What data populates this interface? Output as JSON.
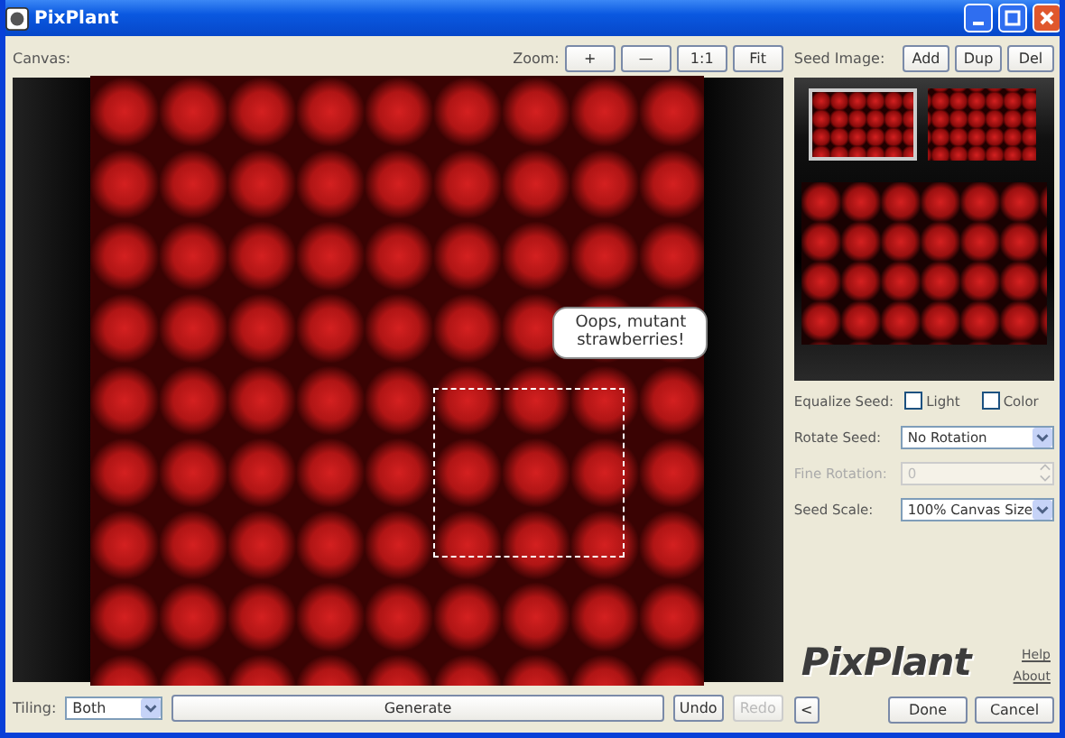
{
  "window": {
    "title": "PixPlant"
  },
  "canvas": {
    "label": "Canvas:",
    "zoom_label": "Zoom:",
    "zoom_buttons": [
      "+",
      "—",
      "1:1",
      "Fit"
    ],
    "callout": "Oops, mutant strawberries!"
  },
  "seed": {
    "label": "Seed Image:",
    "buttons": [
      "Add",
      "Dup",
      "Del"
    ],
    "thumbnails": [
      {
        "selected": true
      },
      {
        "selected": false
      }
    ]
  },
  "settings": {
    "equalize_label": "Equalize Seed:",
    "checkboxes": [
      {
        "label": "Light",
        "checked": false
      },
      {
        "label": "Color",
        "checked": false
      }
    ],
    "fields": [
      {
        "label": "Rotate Seed:",
        "value": "No Rotation",
        "kind": "dropdown",
        "disabled": false
      },
      {
        "label": "Fine Rotation:",
        "value": "0",
        "kind": "spinner",
        "disabled": true
      },
      {
        "label": "Seed Scale:",
        "value": "100% Canvas Size",
        "kind": "dropdown",
        "disabled": false
      }
    ]
  },
  "logo": "PixPlant",
  "links": [
    "Help",
    "About"
  ],
  "footer": {
    "back": "<",
    "buttons": [
      "Done",
      "Cancel"
    ]
  },
  "toolbar": {
    "tiling_label": "Tiling:",
    "tiling_value": "Both",
    "generate": "Generate",
    "actions": [
      {
        "label": "Undo",
        "disabled": false
      },
      {
        "label": "Redo",
        "disabled": true
      }
    ]
  }
}
